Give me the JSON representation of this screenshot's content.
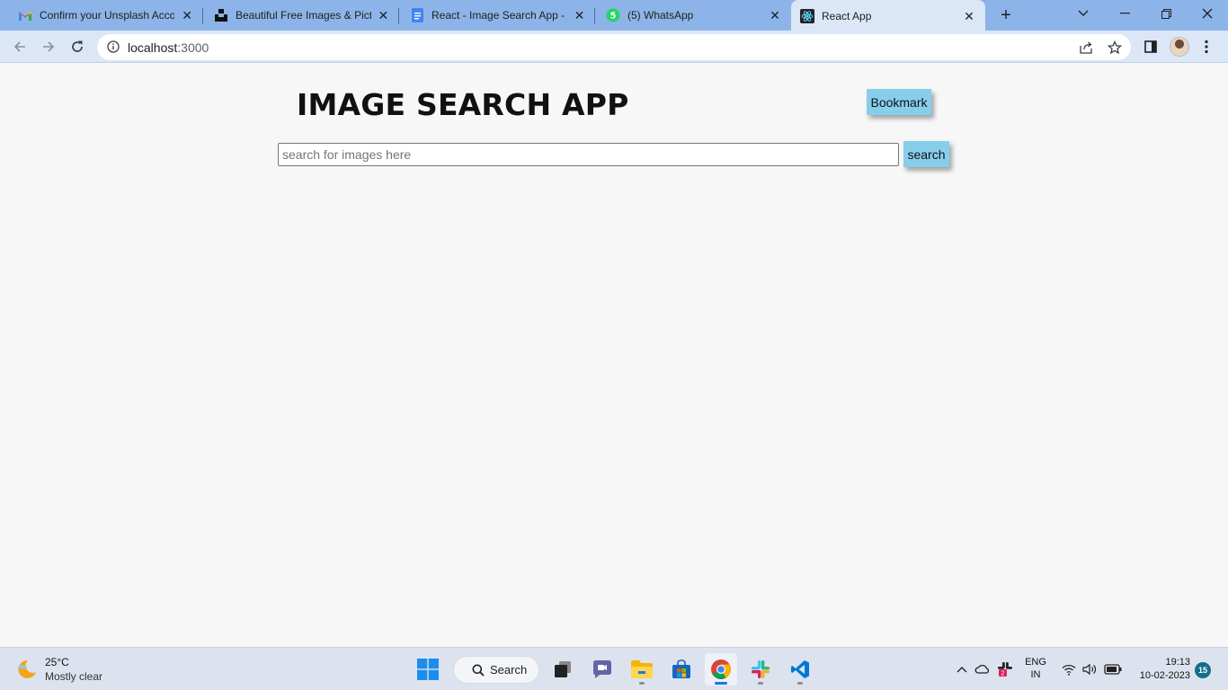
{
  "browser": {
    "tabs": [
      {
        "title": "Confirm your Unsplash Acco",
        "icon": "gmail-icon"
      },
      {
        "title": "Beautiful Free Images & Pictu",
        "icon": "unsplash-icon"
      },
      {
        "title": "React - Image Search App - G",
        "icon": "docs-icon"
      },
      {
        "title": "(5) WhatsApp",
        "icon": "whatsapp-icon",
        "badge": "5"
      },
      {
        "title": "React App",
        "icon": "react-icon",
        "active": true
      }
    ],
    "address": {
      "host": "localhost",
      "port": ":3000"
    },
    "colors": {
      "tabstrip": "#8cb4e8",
      "toolbar": "#dbe6f7"
    }
  },
  "app": {
    "title": "IMAGE SEARCH APP",
    "bookmark_label": "Bookmark",
    "search_placeholder": "search for images here",
    "search_value": "",
    "search_button_label": "search",
    "colors": {
      "button": "#87ceeb",
      "background": "#f7f7f7"
    }
  },
  "taskbar": {
    "weather": {
      "temp": "25°C",
      "condition": "Mostly clear"
    },
    "search_label": "Search",
    "lang": {
      "line1": "ENG",
      "line2": "IN"
    },
    "clock": {
      "time": "19:13",
      "date": "10-02-2023"
    },
    "notifications": "15",
    "slack_badge": "2"
  }
}
